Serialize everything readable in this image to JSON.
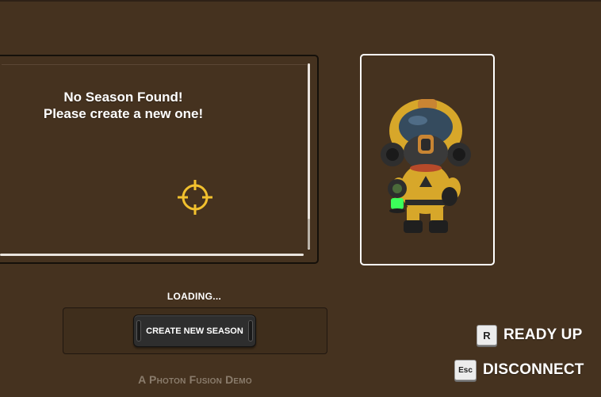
{
  "session_list": {
    "empty_line1": "No Season Found!",
    "empty_line2": "Please create a new one!"
  },
  "status": {
    "loading": "LOADING..."
  },
  "actions": {
    "create_session": "CREATE NEW SEASON"
  },
  "footer": {
    "credit": "A Photon Fusion Demo"
  },
  "key_hints": {
    "ready_key": "R",
    "ready_label": "READY UP",
    "disconnect_key": "Esc",
    "disconnect_label": "DISCONNECT"
  },
  "colors": {
    "background": "#45321f",
    "panel_border": "#15100a",
    "crosshair": "#f2c12e",
    "character_suit": "#d7a72a",
    "character_visor": "#354b5e",
    "lantern_glow": "#3cff5a"
  },
  "icons": {
    "crosshair": "crosshair-icon",
    "character": "hazmat-character"
  }
}
